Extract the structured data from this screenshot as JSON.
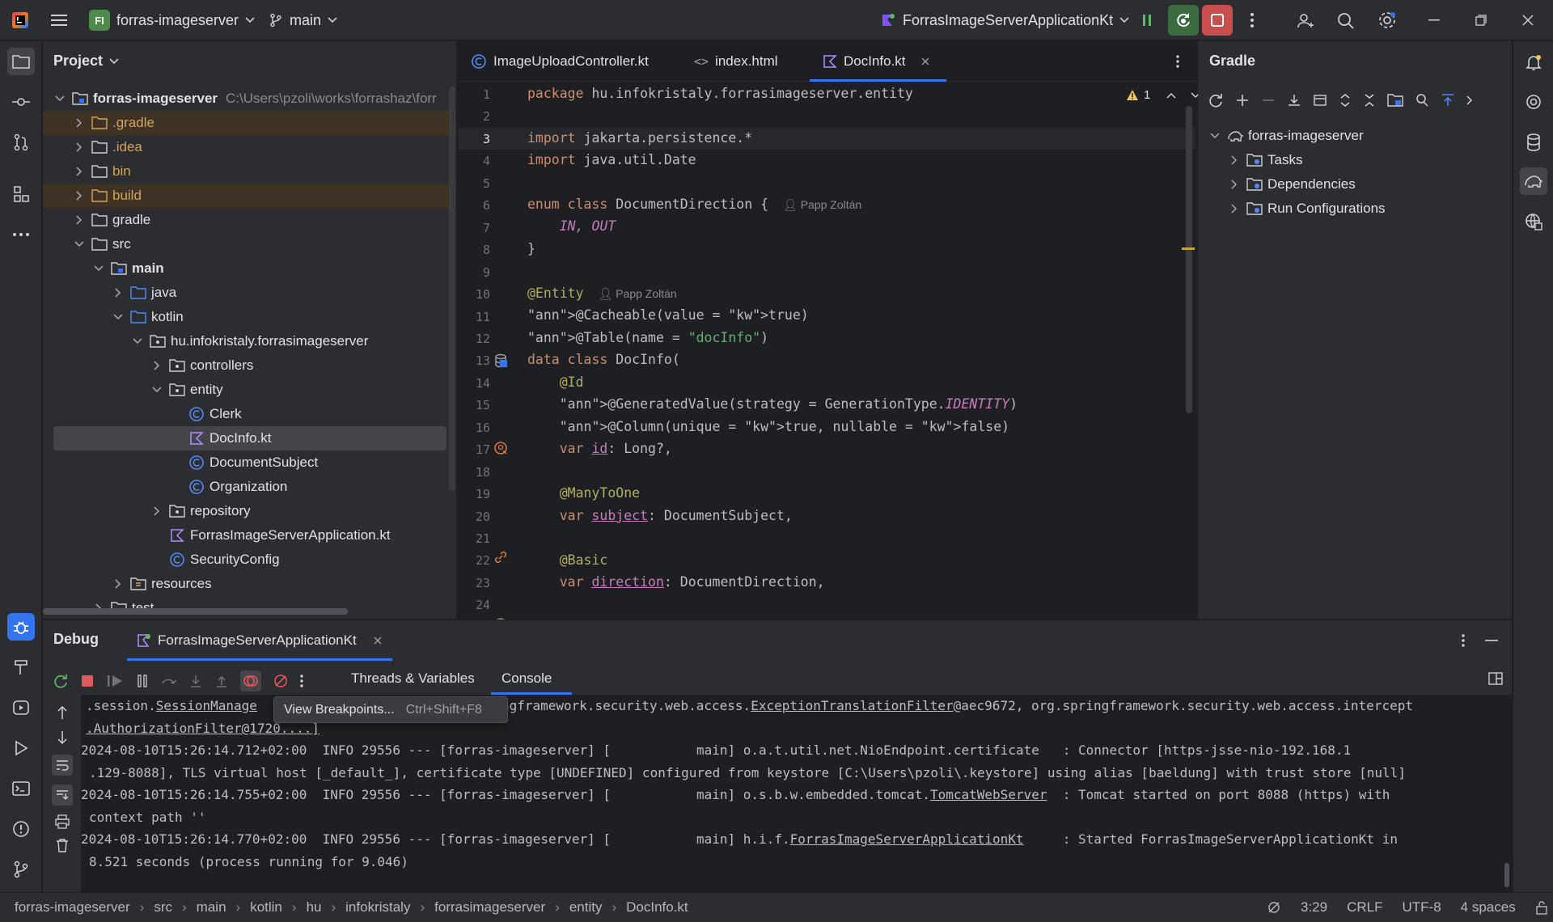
{
  "titlebar": {
    "project_badge": "FI",
    "project_name": "forras-imageserver",
    "branch": "main",
    "run_config": "ForrasImageServerApplicationKt"
  },
  "project_panel": {
    "title": "Project",
    "root_name": "forras-imageserver",
    "root_path": "C:\\Users\\pzoli\\works\\forrashaz\\forr",
    "items": [
      {
        "label": ".gradle"
      },
      {
        "label": ".idea"
      },
      {
        "label": "bin"
      },
      {
        "label": "build"
      },
      {
        "label": "gradle"
      },
      {
        "label": "src"
      },
      {
        "label": "main"
      },
      {
        "label": "java"
      },
      {
        "label": "kotlin"
      },
      {
        "label": "hu.infokristaly.forrasimageserver"
      },
      {
        "label": "controllers"
      },
      {
        "label": "entity"
      },
      {
        "label": "Clerk"
      },
      {
        "label": "DocInfo.kt"
      },
      {
        "label": "DocumentSubject"
      },
      {
        "label": "Organization"
      },
      {
        "label": "repository"
      },
      {
        "label": "ForrasImageServerApplication.kt"
      },
      {
        "label": "SecurityConfig"
      },
      {
        "label": "resources"
      },
      {
        "label": "test"
      }
    ]
  },
  "editor": {
    "tabs": [
      {
        "label": "ImageUploadController.kt"
      },
      {
        "label": "index.html"
      },
      {
        "label": "DocInfo.kt"
      }
    ],
    "warning_count": "1",
    "lines": [
      {
        "n": "1",
        "t": "package hu.infokristaly.forrasimageserver.entity"
      },
      {
        "n": "2",
        "t": ""
      },
      {
        "n": "3",
        "t": "import jakarta.persistence.*"
      },
      {
        "n": "4",
        "t": "import java.util.Date"
      },
      {
        "n": "5",
        "t": ""
      },
      {
        "n": "6",
        "t": "enum class DocumentDirection {"
      },
      {
        "n": "7",
        "t": "    IN, OUT"
      },
      {
        "n": "8",
        "t": "}"
      },
      {
        "n": "9",
        "t": ""
      },
      {
        "n": "10",
        "t": "@Entity"
      },
      {
        "n": "11",
        "t": "@Cacheable(value = true)"
      },
      {
        "n": "12",
        "t": "@Table(name = \"docInfo\")"
      },
      {
        "n": "13",
        "t": "data class DocInfo("
      },
      {
        "n": "14",
        "t": "    @Id"
      },
      {
        "n": "15",
        "t": "    @GeneratedValue(strategy = GenerationType.IDENTITY)"
      },
      {
        "n": "16",
        "t": "    @Column(unique = true, nullable = false)"
      },
      {
        "n": "17",
        "t": "    var id: Long?,"
      },
      {
        "n": "18",
        "t": ""
      },
      {
        "n": "19",
        "t": "    @ManyToOne"
      },
      {
        "n": "20",
        "t": "    var subject: DocumentSubject,"
      },
      {
        "n": "21",
        "t": ""
      },
      {
        "n": "22",
        "t": "    @Basic"
      },
      {
        "n": "23",
        "t": "    var direction: DocumentDirection,"
      },
      {
        "n": "24",
        "t": ""
      }
    ],
    "author_hint": "Papp Zoltán"
  },
  "gradle": {
    "title": "Gradle",
    "root": "forras-imageserver",
    "items": [
      "Tasks",
      "Dependencies",
      "Run Configurations"
    ]
  },
  "debug": {
    "title": "Debug",
    "session_tab": "ForrasImageServerApplicationKt",
    "subtabs": [
      "Threads & Variables",
      "Console"
    ],
    "tooltip_label": "View Breakpoints...",
    "tooltip_shortcut": "Ctrl+Shift+F8",
    "console": [
      ".session.SessionManagementFilter@..., org.springframework.security.web.access.ExceptionTranslationFilter@aec9672, org.springframework.security.web.access.intercept",
      ".AuthorizationFilter@1720....]",
      "2024-08-10T15:26:14.712+02:00  INFO 29556 --- [forras-imageserver] [           main] o.a.t.util.net.NioEndpoint.certificate   : Connector [https-jsse-nio-192.168.1",
      ".129-8088], TLS virtual host [_default_], certificate type [UNDEFINED] configured from keystore [C:\\Users\\pzoli\\.keystore] using alias [baeldung] with trust store [null]",
      "2024-08-10T15:26:14.755+02:00  INFO 29556 --- [forras-imageserver] [           main] o.s.b.w.embedded.tomcat.TomcatWebServer  : Tomcat started on port 8088 (https) with",
      "context path ''",
      "2024-08-10T15:26:14.770+02:00  INFO 29556 --- [forras-imageserver] [           main] h.i.f.ForrasImageServerApplicationKt     : Started ForrasImageServerApplicationKt in",
      "8.521 seconds (process running for 9.046)"
    ]
  },
  "statusbar": {
    "breadcrumbs": [
      "forras-imageserver",
      "src",
      "main",
      "kotlin",
      "hu",
      "infokristaly",
      "forrasimageserver",
      "entity",
      "DocInfo.kt"
    ],
    "position": "3:29",
    "line_ending": "CRLF",
    "encoding": "UTF-8",
    "indent": "4 spaces"
  }
}
